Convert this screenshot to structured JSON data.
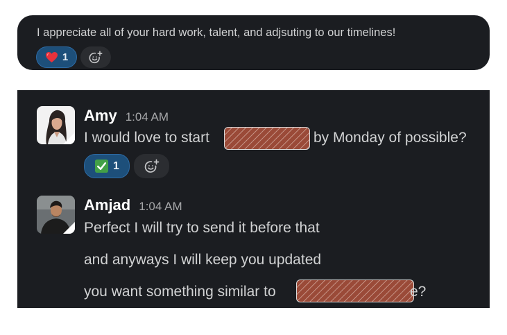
{
  "top_message": {
    "text": "I appreciate all of your hard work, talent, and adjsuting to our timelines!",
    "reaction": {
      "icon": "heart",
      "count": "1"
    }
  },
  "messages": [
    {
      "author": "Amy",
      "time": "1:04 AM",
      "lines": [
        {
          "before": "I would love to start",
          "after": "by Monday of possible?"
        }
      ],
      "reaction": {
        "icon": "check-mark",
        "count": "1"
      }
    },
    {
      "author": "Amjad",
      "time": "1:04 AM",
      "lines": [
        {
          "text": "Perfect I will try to send it before that"
        },
        {
          "text": "and anyways I will keep you updated"
        },
        {
          "before": "you want something similar to",
          "after": "e?"
        }
      ]
    }
  ],
  "colors": {
    "background": "#1b1d21",
    "reaction_active": "#1d4f7a",
    "redaction": "#9a4a38"
  }
}
